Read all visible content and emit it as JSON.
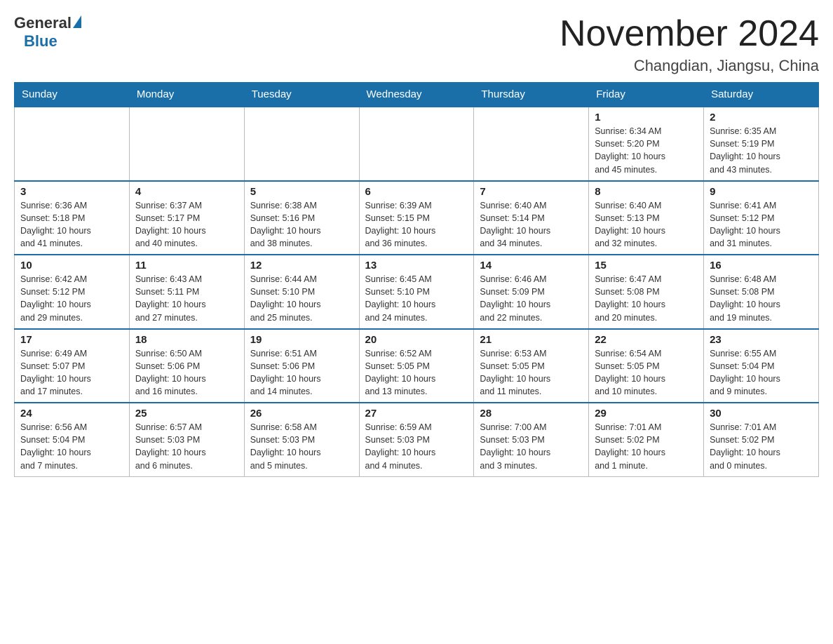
{
  "header": {
    "logo_general": "General",
    "logo_blue": "Blue",
    "month_title": "November 2024",
    "location": "Changdian, Jiangsu, China"
  },
  "weekdays": [
    "Sunday",
    "Monday",
    "Tuesday",
    "Wednesday",
    "Thursday",
    "Friday",
    "Saturday"
  ],
  "weeks": [
    [
      {
        "num": "",
        "info": ""
      },
      {
        "num": "",
        "info": ""
      },
      {
        "num": "",
        "info": ""
      },
      {
        "num": "",
        "info": ""
      },
      {
        "num": "",
        "info": ""
      },
      {
        "num": "1",
        "info": "Sunrise: 6:34 AM\nSunset: 5:20 PM\nDaylight: 10 hours\nand 45 minutes."
      },
      {
        "num": "2",
        "info": "Sunrise: 6:35 AM\nSunset: 5:19 PM\nDaylight: 10 hours\nand 43 minutes."
      }
    ],
    [
      {
        "num": "3",
        "info": "Sunrise: 6:36 AM\nSunset: 5:18 PM\nDaylight: 10 hours\nand 41 minutes."
      },
      {
        "num": "4",
        "info": "Sunrise: 6:37 AM\nSunset: 5:17 PM\nDaylight: 10 hours\nand 40 minutes."
      },
      {
        "num": "5",
        "info": "Sunrise: 6:38 AM\nSunset: 5:16 PM\nDaylight: 10 hours\nand 38 minutes."
      },
      {
        "num": "6",
        "info": "Sunrise: 6:39 AM\nSunset: 5:15 PM\nDaylight: 10 hours\nand 36 minutes."
      },
      {
        "num": "7",
        "info": "Sunrise: 6:40 AM\nSunset: 5:14 PM\nDaylight: 10 hours\nand 34 minutes."
      },
      {
        "num": "8",
        "info": "Sunrise: 6:40 AM\nSunset: 5:13 PM\nDaylight: 10 hours\nand 32 minutes."
      },
      {
        "num": "9",
        "info": "Sunrise: 6:41 AM\nSunset: 5:12 PM\nDaylight: 10 hours\nand 31 minutes."
      }
    ],
    [
      {
        "num": "10",
        "info": "Sunrise: 6:42 AM\nSunset: 5:12 PM\nDaylight: 10 hours\nand 29 minutes."
      },
      {
        "num": "11",
        "info": "Sunrise: 6:43 AM\nSunset: 5:11 PM\nDaylight: 10 hours\nand 27 minutes."
      },
      {
        "num": "12",
        "info": "Sunrise: 6:44 AM\nSunset: 5:10 PM\nDaylight: 10 hours\nand 25 minutes."
      },
      {
        "num": "13",
        "info": "Sunrise: 6:45 AM\nSunset: 5:10 PM\nDaylight: 10 hours\nand 24 minutes."
      },
      {
        "num": "14",
        "info": "Sunrise: 6:46 AM\nSunset: 5:09 PM\nDaylight: 10 hours\nand 22 minutes."
      },
      {
        "num": "15",
        "info": "Sunrise: 6:47 AM\nSunset: 5:08 PM\nDaylight: 10 hours\nand 20 minutes."
      },
      {
        "num": "16",
        "info": "Sunrise: 6:48 AM\nSunset: 5:08 PM\nDaylight: 10 hours\nand 19 minutes."
      }
    ],
    [
      {
        "num": "17",
        "info": "Sunrise: 6:49 AM\nSunset: 5:07 PM\nDaylight: 10 hours\nand 17 minutes."
      },
      {
        "num": "18",
        "info": "Sunrise: 6:50 AM\nSunset: 5:06 PM\nDaylight: 10 hours\nand 16 minutes."
      },
      {
        "num": "19",
        "info": "Sunrise: 6:51 AM\nSunset: 5:06 PM\nDaylight: 10 hours\nand 14 minutes."
      },
      {
        "num": "20",
        "info": "Sunrise: 6:52 AM\nSunset: 5:05 PM\nDaylight: 10 hours\nand 13 minutes."
      },
      {
        "num": "21",
        "info": "Sunrise: 6:53 AM\nSunset: 5:05 PM\nDaylight: 10 hours\nand 11 minutes."
      },
      {
        "num": "22",
        "info": "Sunrise: 6:54 AM\nSunset: 5:05 PM\nDaylight: 10 hours\nand 10 minutes."
      },
      {
        "num": "23",
        "info": "Sunrise: 6:55 AM\nSunset: 5:04 PM\nDaylight: 10 hours\nand 9 minutes."
      }
    ],
    [
      {
        "num": "24",
        "info": "Sunrise: 6:56 AM\nSunset: 5:04 PM\nDaylight: 10 hours\nand 7 minutes."
      },
      {
        "num": "25",
        "info": "Sunrise: 6:57 AM\nSunset: 5:03 PM\nDaylight: 10 hours\nand 6 minutes."
      },
      {
        "num": "26",
        "info": "Sunrise: 6:58 AM\nSunset: 5:03 PM\nDaylight: 10 hours\nand 5 minutes."
      },
      {
        "num": "27",
        "info": "Sunrise: 6:59 AM\nSunset: 5:03 PM\nDaylight: 10 hours\nand 4 minutes."
      },
      {
        "num": "28",
        "info": "Sunrise: 7:00 AM\nSunset: 5:03 PM\nDaylight: 10 hours\nand 3 minutes."
      },
      {
        "num": "29",
        "info": "Sunrise: 7:01 AM\nSunset: 5:02 PM\nDaylight: 10 hours\nand 1 minute."
      },
      {
        "num": "30",
        "info": "Sunrise: 7:01 AM\nSunset: 5:02 PM\nDaylight: 10 hours\nand 0 minutes."
      }
    ]
  ]
}
